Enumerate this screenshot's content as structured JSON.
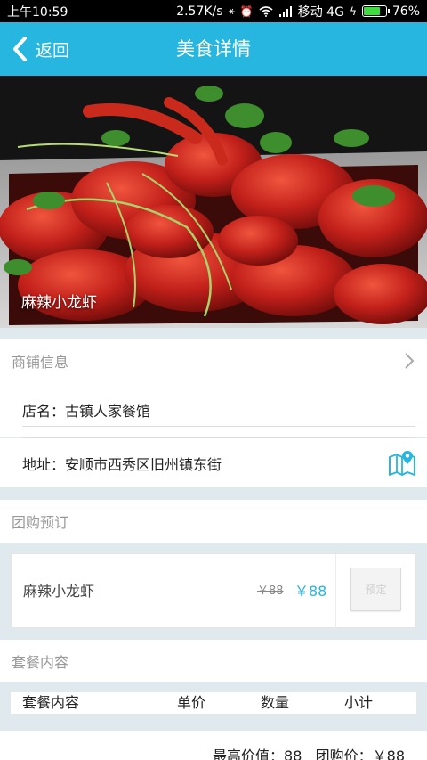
{
  "status_bar": {
    "time": "上午10:59",
    "speed": "2.57K/s",
    "carrier": "移动 4G",
    "battery": "76%",
    "battery_level": 0.76,
    "icons": [
      "usb-icon",
      "alarm-icon",
      "wifi-icon",
      "signal-icon",
      "charging-icon",
      "battery-icon"
    ]
  },
  "nav": {
    "back_label": "返回",
    "title": "美食详情",
    "bg_color": "#27b6e0"
  },
  "hero": {
    "label": "麻辣小龙虾"
  },
  "shop_section": {
    "title": "商铺信息",
    "name": "店名：古镇人家餐馆",
    "address": "地址：安顺市西秀区旧州镇东街"
  },
  "group_section": {
    "title": "团购预订",
    "deal_name": "麻辣小龙虾",
    "old_price": "￥88",
    "new_price": "￥88",
    "book_label": "预定"
  },
  "package_section": {
    "title": "套餐内容",
    "columns": [
      "套餐内容",
      "单价",
      "数量",
      "小计"
    ]
  },
  "footer": {
    "summary": "最高价值：88   团购价：￥88"
  }
}
